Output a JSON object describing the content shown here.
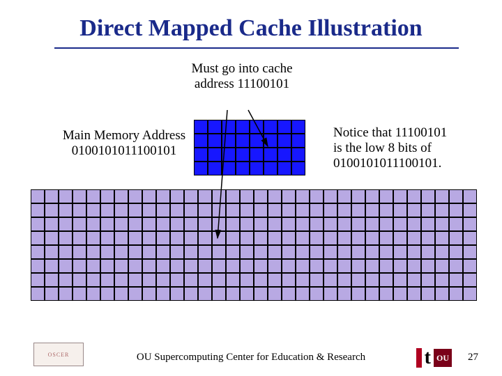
{
  "title": "Direct Mapped Cache Illustration",
  "must_go": "Must go into cache address 11100101",
  "main_mem_caption_l1": "Main Memory Address",
  "main_mem_caption_l2": "0100101011100101",
  "notice_l1": "Notice that 11100101",
  "notice_l2": "is the low 8 bits of",
  "notice_l3": "0100101011100101.",
  "footer": "OU Supercomputing Center for Education & Research",
  "page_number": "27",
  "cache_grid": {
    "rows": 4,
    "cols": 8
  },
  "mem_grid": {
    "rows": 8,
    "cols": 32
  },
  "logo_left_text": "OSCER",
  "logo_ou": "OU"
}
